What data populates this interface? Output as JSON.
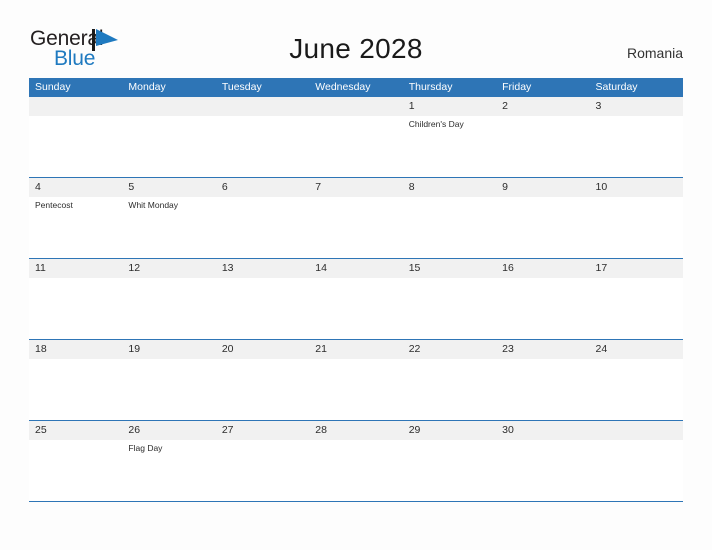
{
  "brand": {
    "name_part1": "General",
    "name_part2": "Blue",
    "flag_icon": "flag-triangle-icon",
    "accent_color": "#1f7ac0"
  },
  "header": {
    "title": "June 2028",
    "country": "Romania"
  },
  "theme": {
    "header_blue": "#2e75b6",
    "date_band_gray": "#f1f1f1",
    "page_background": "#fdfdfd",
    "text_color": "#2c2c2c"
  },
  "calendar": {
    "month": "June",
    "year": "2028",
    "weekday_headers": [
      "Sunday",
      "Monday",
      "Tuesday",
      "Wednesday",
      "Thursday",
      "Friday",
      "Saturday"
    ],
    "weeks": [
      [
        {
          "date": "",
          "events": []
        },
        {
          "date": "",
          "events": []
        },
        {
          "date": "",
          "events": []
        },
        {
          "date": "",
          "events": []
        },
        {
          "date": "1",
          "events": [
            "Children's Day"
          ]
        },
        {
          "date": "2",
          "events": []
        },
        {
          "date": "3",
          "events": []
        }
      ],
      [
        {
          "date": "4",
          "events": [
            "Pentecost"
          ]
        },
        {
          "date": "5",
          "events": [
            "Whit Monday"
          ]
        },
        {
          "date": "6",
          "events": []
        },
        {
          "date": "7",
          "events": []
        },
        {
          "date": "8",
          "events": []
        },
        {
          "date": "9",
          "events": []
        },
        {
          "date": "10",
          "events": []
        }
      ],
      [
        {
          "date": "11",
          "events": []
        },
        {
          "date": "12",
          "events": []
        },
        {
          "date": "13",
          "events": []
        },
        {
          "date": "14",
          "events": []
        },
        {
          "date": "15",
          "events": []
        },
        {
          "date": "16",
          "events": []
        },
        {
          "date": "17",
          "events": []
        }
      ],
      [
        {
          "date": "18",
          "events": []
        },
        {
          "date": "19",
          "events": []
        },
        {
          "date": "20",
          "events": []
        },
        {
          "date": "21",
          "events": []
        },
        {
          "date": "22",
          "events": []
        },
        {
          "date": "23",
          "events": []
        },
        {
          "date": "24",
          "events": []
        }
      ],
      [
        {
          "date": "25",
          "events": []
        },
        {
          "date": "26",
          "events": [
            "Flag Day"
          ]
        },
        {
          "date": "27",
          "events": []
        },
        {
          "date": "28",
          "events": []
        },
        {
          "date": "29",
          "events": []
        },
        {
          "date": "30",
          "events": []
        },
        {
          "date": "",
          "events": []
        }
      ]
    ]
  }
}
